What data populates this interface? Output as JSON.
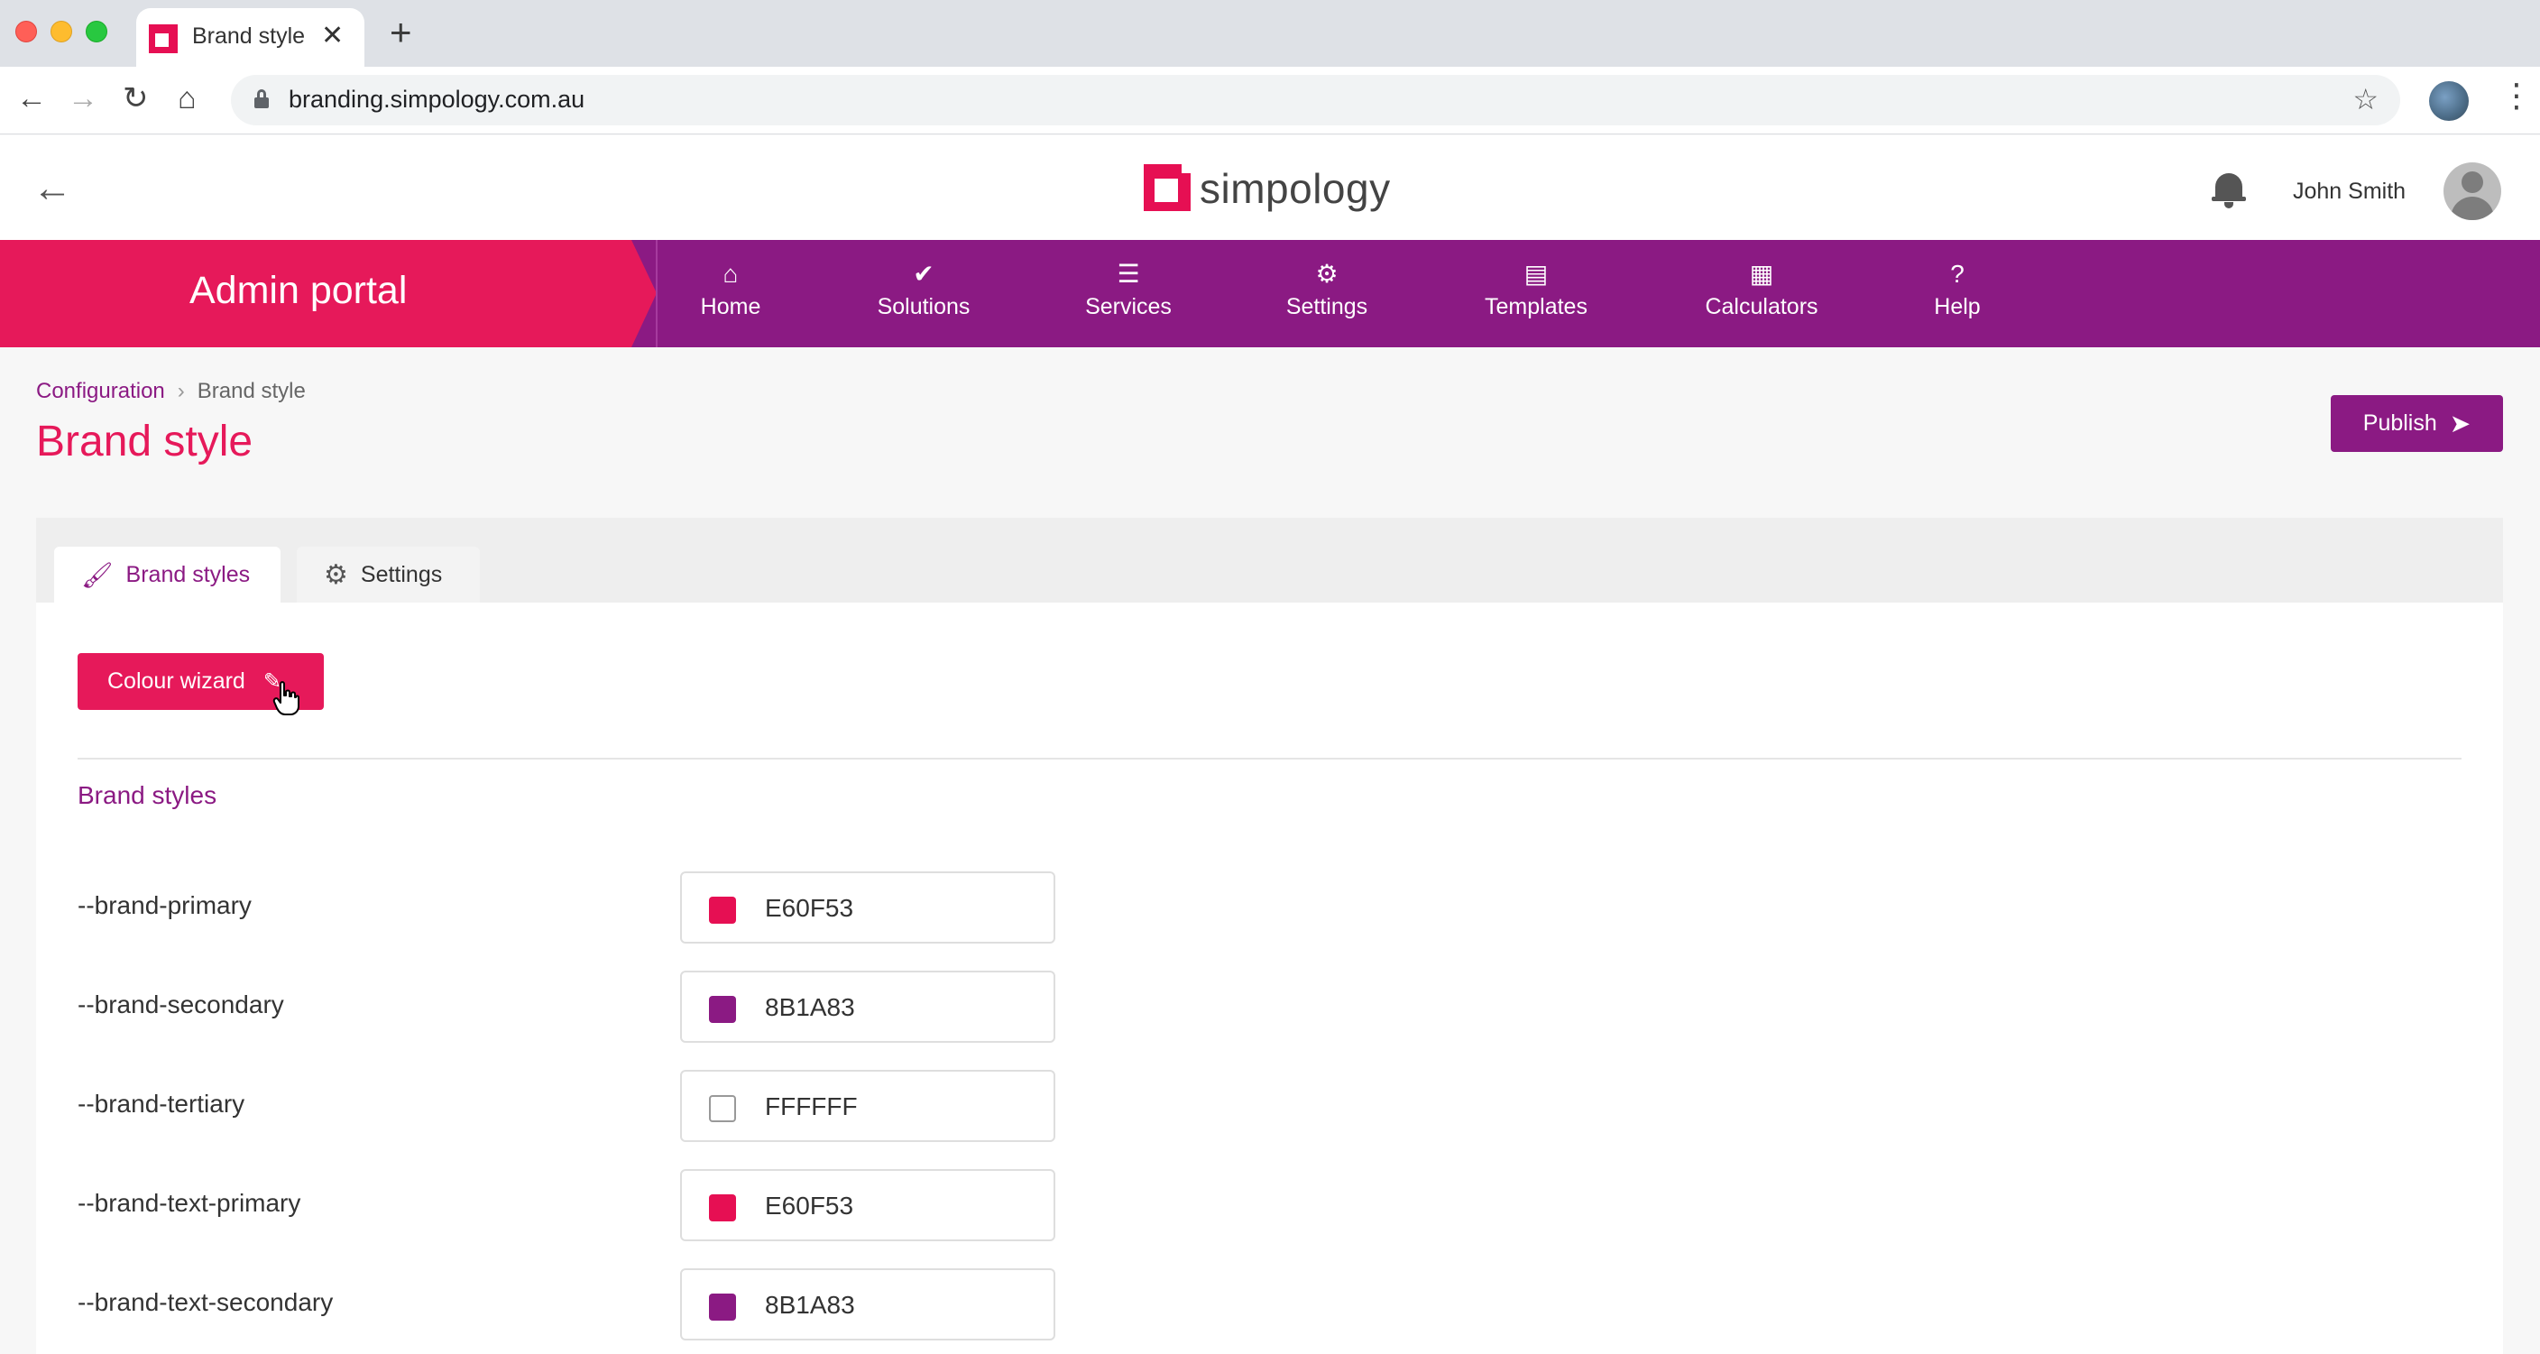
{
  "browser": {
    "tab_title": "Brand style",
    "tab_close": "✕",
    "new_tab": "+",
    "url": "branding.simpology.com.au",
    "back": "←",
    "forward": "→",
    "reload": "↻",
    "home": "⌂",
    "star": "☆",
    "menu": "⋮"
  },
  "header": {
    "logo_text": "simpology",
    "back_arrow": "←",
    "user_name": "John Smith"
  },
  "nav": {
    "portal_title": "Admin portal",
    "items": [
      {
        "label": "Home",
        "icon": "home-icon",
        "glyph": "⌂"
      },
      {
        "label": "Solutions",
        "icon": "check-circle-icon",
        "glyph": "✔"
      },
      {
        "label": "Services",
        "icon": "list-icon",
        "glyph": "☰"
      },
      {
        "label": "Settings",
        "icon": "gear-icon",
        "glyph": "⚙"
      },
      {
        "label": "Templates",
        "icon": "document-icon",
        "glyph": "▤"
      },
      {
        "label": "Calculators",
        "icon": "grid-icon",
        "glyph": "▦"
      },
      {
        "label": "Help",
        "icon": "question-circle-icon",
        "glyph": "?"
      }
    ]
  },
  "breadcrumb": {
    "parent": "Configuration",
    "separator": "›",
    "current": "Brand style"
  },
  "page": {
    "title": "Brand style",
    "publish_label": "Publish",
    "publish_icon": "➤"
  },
  "tabs": {
    "brand_styles": "Brand styles",
    "settings": "Settings",
    "brush_glyph": "🖌",
    "gear_glyph": "⚙"
  },
  "wizard": {
    "label": "Colour wizard",
    "icon_glyph": "✎"
  },
  "section": {
    "title": "Brand styles"
  },
  "styles": [
    {
      "name": "--brand-primary",
      "value": "E60F53",
      "color": "#E60F53"
    },
    {
      "name": "--brand-secondary",
      "value": "8B1A83",
      "color": "#8B1A83"
    },
    {
      "name": "--brand-tertiary",
      "value": "FFFFFF",
      "color": "#FFFFFF"
    },
    {
      "name": "--brand-text-primary",
      "value": "E60F53",
      "color": "#E60F53"
    },
    {
      "name": "--brand-text-secondary",
      "value": "8B1A83",
      "color": "#8B1A83"
    }
  ],
  "colors": {
    "brand_primary": "#E60F53",
    "brand_secondary": "#8B1A83",
    "nav_background": "#8B1A83",
    "portal_banner": "#E6195A"
  }
}
